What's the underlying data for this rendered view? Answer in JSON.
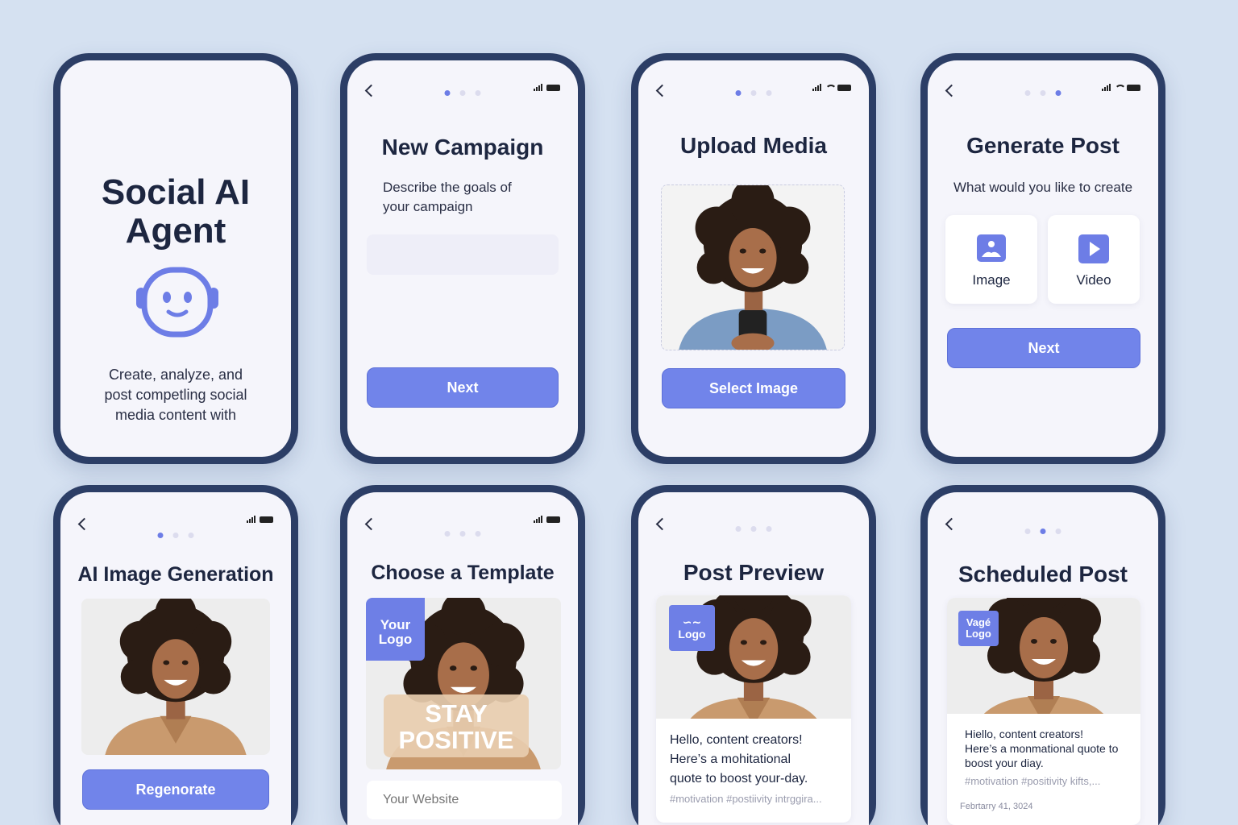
{
  "colors": {
    "background": "#d5e1f1",
    "frame": "#2c3e66",
    "accent": "#7184ea",
    "screen": "#f5f5fb"
  },
  "screen1": {
    "title_line1": "Social AI",
    "title_line2": "Agent",
    "icon": "robot-face-icon",
    "description_line1": "Create, analyze, and",
    "description_line2": "post competling social",
    "description_line3": "media content with"
  },
  "screen2": {
    "title": "New Campaign",
    "subtitle_line1": "Describe the goals of",
    "subtitle_line2": "your campaign",
    "input_placeholder": "",
    "button": "Next"
  },
  "screen3": {
    "title": "Upload Media",
    "button": "Select Image"
  },
  "screen4": {
    "title": "Generate Post",
    "subtitle": "What would you like to create",
    "options": [
      {
        "label": "Image",
        "icon": "image-icon"
      },
      {
        "label": "Video",
        "icon": "video-play-icon"
      }
    ],
    "button": "Next"
  },
  "screen5": {
    "title": "AI Image Generation",
    "button": "Regenorate"
  },
  "screen6": {
    "title": "Choose a Template",
    "logo_line1": "Your",
    "logo_line2": "Logo",
    "overlay_line1": "STAY",
    "overlay_line2": "POSITIVE",
    "website_placeholder": "Your Website"
  },
  "screen7": {
    "title": "Post Preview",
    "logo_mark": "∽∼",
    "logo_text": "Logo",
    "caption_line1": "Hello, content creators!",
    "caption_line2": "Here’s a mohitational",
    "caption_line3": "quote to boost your-day.",
    "hashtags": "#motivation #postiivity intrggira..."
  },
  "screen8": {
    "title": "Scheduled Post",
    "logo_line1": "Vagé",
    "logo_line2": "Logo",
    "caption_line1": "Hiello, content creators!",
    "caption_line2": "Here’s a monmational quote to",
    "caption_line3": "boost your diay.",
    "hashtags": "#motivation #positivity kifts,...",
    "date": "Febrtarry 41, 3024"
  }
}
